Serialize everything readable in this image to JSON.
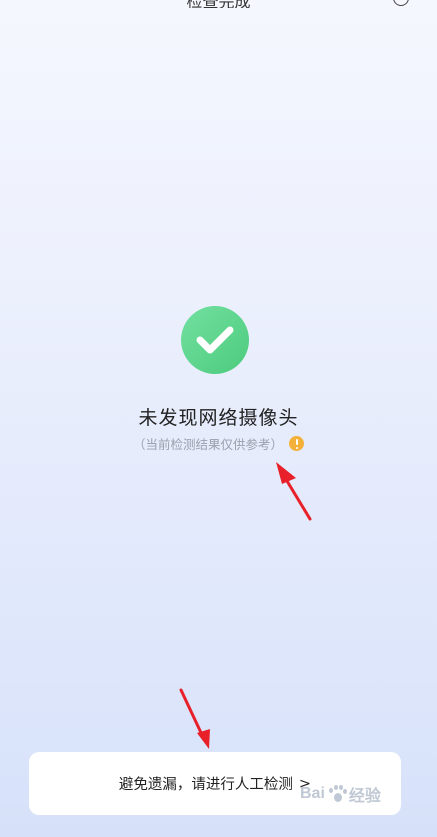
{
  "header": {
    "title": "检查完成"
  },
  "result": {
    "title": "未发现网络摄像头",
    "note": "（当前检测结果仅供参考）"
  },
  "manual_check": {
    "label": "避免遗漏，请进行人工检测",
    "chevron": ">"
  },
  "watermark": {
    "text_left": "Bai",
    "text_right": "经验"
  },
  "colors": {
    "success": "#4ccb7d",
    "warning": "#f4b13a",
    "annotation_arrow": "#e8202a"
  },
  "icons": {
    "status": "checkmark-icon",
    "info": "exclamation-icon",
    "menu": "more-icon"
  }
}
